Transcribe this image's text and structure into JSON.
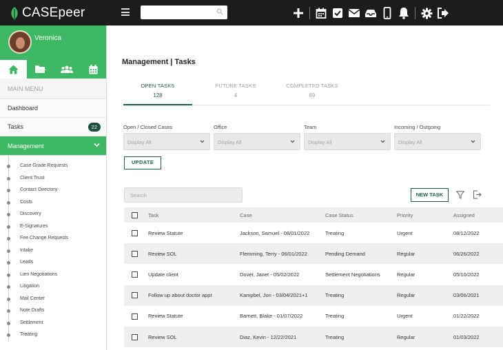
{
  "app": {
    "logo_text": "CASEpeer",
    "brand_color": "#3fb864",
    "accent_color": "#1b5e4c",
    "topbar_icons": [
      "plus-icon",
      "calendar-icon",
      "checkbox-icon",
      "mail-icon",
      "inbox-icon",
      "phone-icon",
      "bell-icon",
      "gear-icon",
      "logout-icon"
    ]
  },
  "search": {
    "placeholder": ""
  },
  "user": {
    "name": "Veronica"
  },
  "sidebar": {
    "tab_icons": [
      "home-icon",
      "folder-icon",
      "users-icon",
      "calendar-icon"
    ],
    "main_menu_label": "MAIN MENU",
    "dashboard_label": "Dashboard",
    "tasks_label": "Tasks",
    "tasks_count": "22",
    "management_label": "Management",
    "submenu": [
      "Case Grade Requests",
      "Client Trust",
      "Contact Directory",
      "Costs",
      "Discovery",
      "E-Signatures",
      "Fee Change Requests",
      "Intake",
      "Leads",
      "Lien Negotiations",
      "Litigation",
      "Mail Center",
      "Note Drafts",
      "Settlement",
      "Treating"
    ]
  },
  "page": {
    "title": "Management | Tasks"
  },
  "tabs": [
    {
      "label": "OPEN TASKS",
      "count": "128"
    },
    {
      "label": "FUTURE TASKS",
      "count": "4"
    },
    {
      "label": "COMPLETED TASKS",
      "count": "89"
    }
  ],
  "filters": [
    {
      "label": "Open / Closed Cases",
      "value": "Display All"
    },
    {
      "label": "Office",
      "value": "Display All"
    },
    {
      "label": "Team",
      "value": "Display All"
    },
    {
      "label": "Incoming / Outgoing",
      "value": "Display All"
    }
  ],
  "update_label": "UPDATE",
  "table_search": {
    "placeholder": "Search"
  },
  "new_task_label": "NEW TASK",
  "table": {
    "headers": [
      "Task",
      "Case",
      "Case Status",
      "Priority",
      "Assigned"
    ],
    "rows": [
      {
        "task": "Review Statute",
        "case": "Jackson, Samuel - 08/01/2022",
        "status": "Treating",
        "priority": "Urgent",
        "assigned": "08/12/2022"
      },
      {
        "task": "Review SOL",
        "case": "Flemming, Terry - 06/01/2022",
        "status": "Pending Demand",
        "priority": "Regular",
        "assigned": "06/26/2022"
      },
      {
        "task": "Update client",
        "case": "Dover, Janet - 05/02/2022",
        "status": "Settlement Negotiations",
        "priority": "Regular",
        "assigned": "05/10/2022"
      },
      {
        "task": "Follow up about doctor appt",
        "case": "Kampbel, Jon - 03/04/2021+1",
        "status": "Treating",
        "priority": "Regular",
        "assigned": "03/06/2021"
      },
      {
        "task": "Review Statute",
        "case": "Barnett, Blake - 01/07/2022",
        "status": "Treating",
        "priority": "Urgent",
        "assigned": "01/22/2022"
      },
      {
        "task": "Review SOL",
        "case": "Diaz, Kevin - 12/22/2021",
        "status": "Treating",
        "priority": "Regular",
        "assigned": "01/03/2022"
      }
    ]
  }
}
